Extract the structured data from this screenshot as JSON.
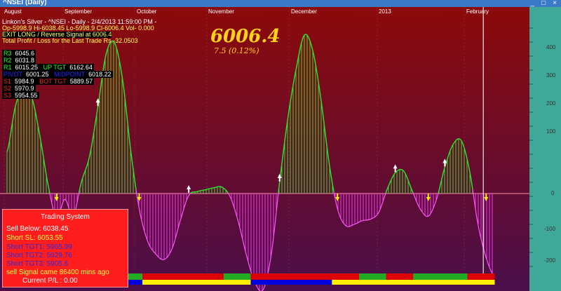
{
  "window": {
    "title": "^NSEI (Daily)",
    "controls": [
      "_",
      "□",
      "×"
    ]
  },
  "header": {
    "line1": "Linkon's Silver - ^NSEI - Daily - 2/4/2013 11:59:00 PM -",
    "line2": "Op-5998.9  Hi-6038.45  Lo-5998.9  Cl-6006.4  Vol-   0.000",
    "line3": "EXIT LONG / Reverse Signal at 6006.4",
    "line4": "Total Profit / Loss for the Last Trade Rs.-32.0503"
  },
  "levels": [
    {
      "label": "R3",
      "value": "6045.6"
    },
    {
      "label": "R2",
      "value": "6031.8"
    },
    {
      "label": "R1",
      "value": "6015.25",
      "tgt_label": "UP TGT",
      "tgt_value": "6162.64"
    },
    {
      "label": "PIVOT",
      "value": "6001.25",
      "mid_label": "MIDPOINT",
      "mid_value": "6018.22"
    },
    {
      "label": "S1",
      "value": "5984.9",
      "tgt_label": "BOT TGT",
      "tgt_value": "5889.57"
    },
    {
      "label": "S2",
      "value": "5970.9"
    },
    {
      "label": "S3",
      "value": "5954.55"
    }
  ],
  "price": {
    "last": "6006.4",
    "change": "7.5  (0.12%)"
  },
  "months": [
    "August",
    "September",
    "October",
    "November",
    "December",
    "2013",
    "February"
  ],
  "trading_system": {
    "title": "Trading System",
    "lines": [
      {
        "text": "Sell Below: 6038.45",
        "color": "#ffffff"
      },
      {
        "text": "Short SL: 6053.55",
        "color": "#ffff4a"
      },
      {
        "text": "Short TGT1: 5965.99",
        "color": "#2a2ad8"
      },
      {
        "text": "Short TGT2: 5929.76",
        "color": "#2a2ad8"
      },
      {
        "text": "Short TGT3: 5905.6",
        "color": "#2a2ad8"
      },
      {
        "text": "sell Signal came 86400 mins ago",
        "color": "#ffff4a"
      },
      {
        "text": "Current P/L : 0.00",
        "color": "#ffffff"
      }
    ]
  },
  "chart_data": {
    "type": "area",
    "y_axis_labels": [
      "400",
      "300",
      "200",
      "100",
      "0",
      "-100",
      "-200"
    ],
    "ylim": [
      -255,
      460
    ],
    "zero_line": 0,
    "series": [
      {
        "values": [
          110,
          230,
          280,
          255,
          150,
          20,
          -65,
          -15,
          -60,
          30,
          100,
          230,
          370,
          400,
          300,
          110,
          -40,
          -125,
          -160,
          -175,
          -145,
          -70,
          -5,
          5,
          10,
          15,
          17,
          -8,
          -75,
          -165,
          -235,
          -255,
          -160,
          30,
          200,
          330,
          420,
          380,
          250,
          80,
          -40,
          -85,
          -82,
          -72,
          -68,
          -50,
          10,
          55,
          60,
          10,
          -40,
          -60,
          -15,
          70,
          130,
          140,
          60,
          -80,
          -170,
          -220
        ]
      }
    ],
    "signals": [
      {
        "index": 6,
        "kind": "sell"
      },
      {
        "index": 11,
        "kind": "buy"
      },
      {
        "index": 16,
        "kind": "sell"
      },
      {
        "index": 22,
        "kind": "buy"
      },
      {
        "index": 33,
        "kind": "buy"
      },
      {
        "index": 40,
        "kind": "sell"
      },
      {
        "index": 47,
        "kind": "buy"
      },
      {
        "index": 51,
        "kind": "sell"
      },
      {
        "index": 53,
        "kind": "buy"
      },
      {
        "index": 58,
        "kind": "sell"
      }
    ],
    "cursor_index": 58,
    "colors": {
      "positive": "#22e622",
      "negative": "#ff33ff",
      "background_top": "#8c0a0a",
      "background_bottom": "#4a0e4a",
      "axis_panel": "#40a898"
    }
  },
  "bottom_bars": {
    "upper": [
      "#dd0000",
      "#dd0000",
      "#dd0000",
      "#dd0000",
      "#22aa22",
      "#dd0000",
      "#dd0000",
      "#dd0000",
      "#22aa22",
      "#dd0000",
      "#dd0000",
      "#dd0000",
      "#dd0000",
      "#22aa22",
      "#dd0000",
      "#22aa22",
      "#22aa22",
      "#dd0000"
    ],
    "lower": [
      "#ffee00",
      "#ffee00",
      "#0000dd",
      "#0000dd",
      "#0000dd",
      "#ffee00",
      "#ffee00",
      "#ffee00",
      "#ffee00",
      "#0000dd",
      "#0000dd",
      "#0000dd",
      "#ffee00",
      "#ffee00",
      "#ffee00",
      "#ffee00",
      "#ffee00",
      "#ffee00"
    ]
  }
}
